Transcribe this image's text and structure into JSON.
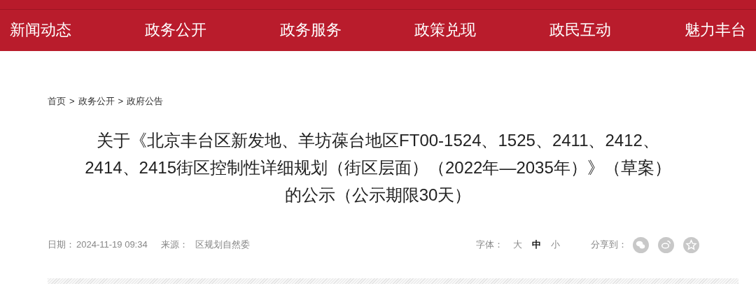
{
  "nav": [
    "新闻动态",
    "政务公开",
    "政务服务",
    "政策兑现",
    "政民互动",
    "魅力丰台"
  ],
  "breadcrumb": {
    "items": [
      "首页",
      "政务公开",
      "政府公告"
    ],
    "separator": ">"
  },
  "title_lines": [
    "关于《北京丰台区新发地、羊坊葆台地区FT00-1524、1525、2411、2412、",
    "2414、2415街区控制性详细规划（街区层面）（2022年—2035年）》（草案）",
    "的公示（公示期限30天）"
  ],
  "meta": {
    "date_label": "日期：",
    "date": "2024-11-19 09:34",
    "source_label": "来源：",
    "source": "区规划自然委"
  },
  "font_size": {
    "label": "字体：",
    "options": [
      {
        "label": "大",
        "selected": false
      },
      {
        "label": "中",
        "selected": true
      },
      {
        "label": "小",
        "selected": false
      }
    ]
  },
  "share": {
    "label": "分享到：",
    "targets": [
      {
        "kind": "wechat"
      },
      {
        "kind": "weibo"
      },
      {
        "kind": "qzone"
      }
    ]
  }
}
